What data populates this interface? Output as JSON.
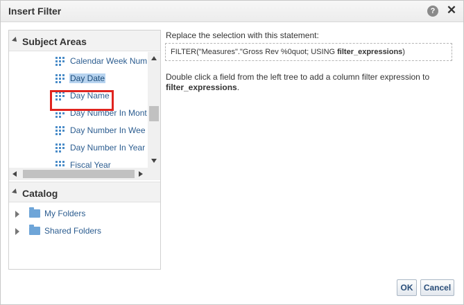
{
  "dialog": {
    "title": "Insert Filter",
    "help_icon": "?",
    "close_icon": "✕"
  },
  "subject_areas": {
    "header": "Subject Areas",
    "items": [
      {
        "label": "Calendar Week Num",
        "selected": false
      },
      {
        "label": "Day Date",
        "selected": true
      },
      {
        "label": "Day Name",
        "selected": false
      },
      {
        "label": "Day Number In Mont",
        "selected": false
      },
      {
        "label": "Day Number In Wee",
        "selected": false
      },
      {
        "label": "Day Number In Year",
        "selected": false
      },
      {
        "label": "Fiscal Year",
        "selected": false
      }
    ]
  },
  "catalog": {
    "header": "Catalog",
    "folders": [
      {
        "label": "My Folders"
      },
      {
        "label": "Shared Folders"
      }
    ]
  },
  "statement": {
    "instruction": "Replace the selection with this statement:",
    "prefix": "FILTER(\"Measures\".\"Gross Rev %0quot; USING ",
    "bold_part": "filter_expressions",
    "suffix": ")"
  },
  "description": {
    "text": "Double click a field from the left tree to add a column filter expression to ",
    "bold_part": "filter_expressions",
    "suffix": "."
  },
  "buttons": {
    "ok": "OK",
    "cancel": "Cancel"
  },
  "colors": {
    "highlight_border": "#e0241f",
    "selection_bg": "#b7d3ef",
    "link_text": "#2b5c8f",
    "column_icon": "#4a8cc8",
    "folder_icon": "#6ea5d8"
  }
}
